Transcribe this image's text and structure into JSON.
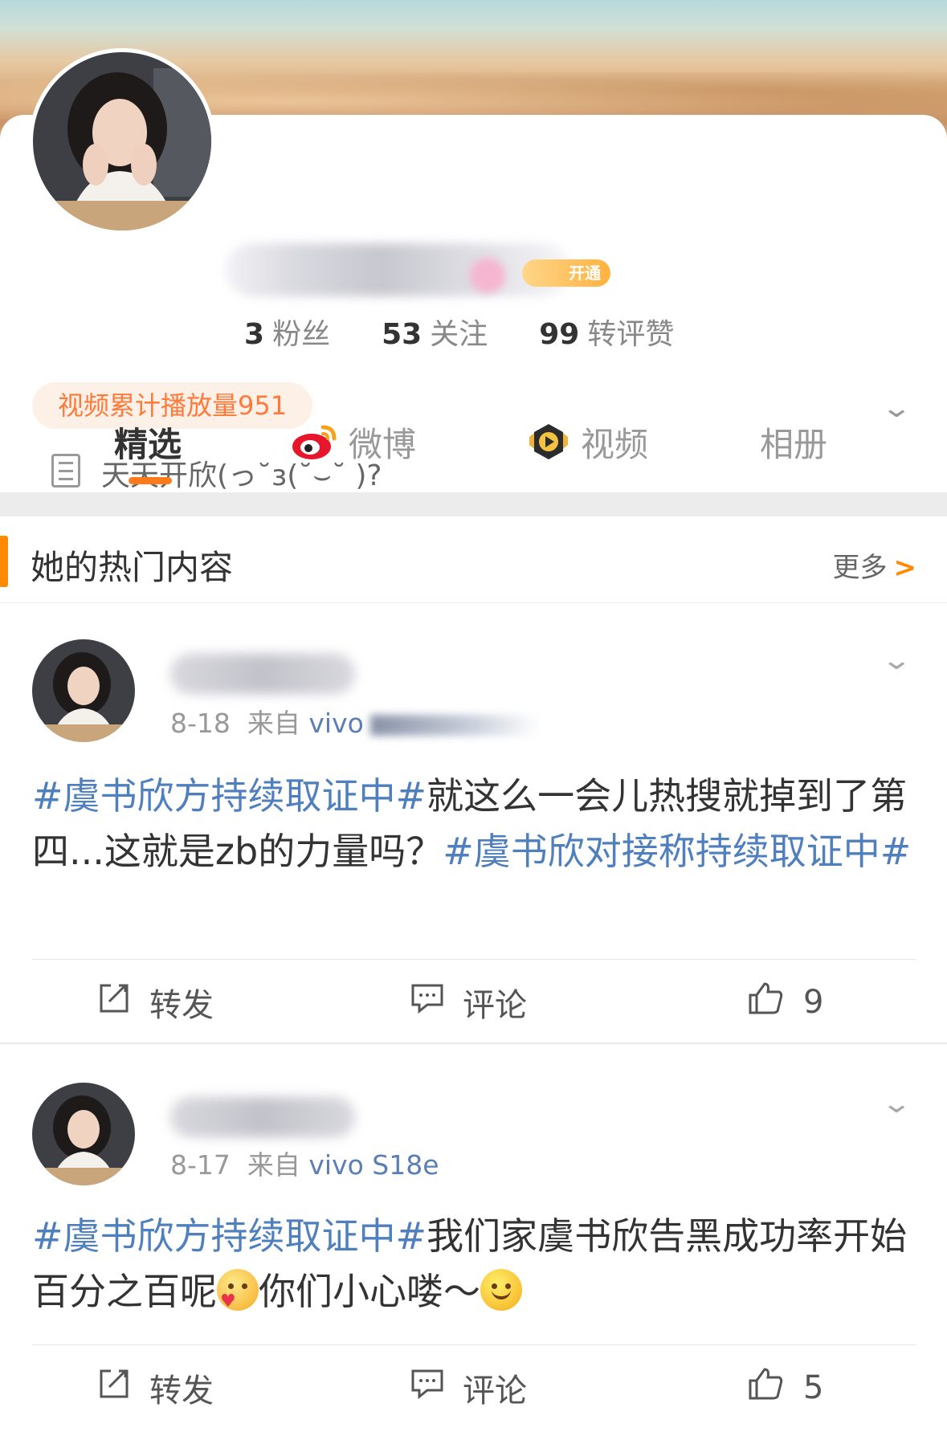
{
  "profile": {
    "vip_badge": "开通",
    "stats": [
      {
        "num": "3",
        "label": "粉丝"
      },
      {
        "num": "53",
        "label": "关注"
      },
      {
        "num": "99",
        "label": "转评赞"
      }
    ],
    "play_count_pill": "视频累计播放量951",
    "bio": "天天开欣(っ˘з(˘⌣˘ )?"
  },
  "tabs": [
    {
      "label": "精选",
      "active": true
    },
    {
      "label": "微博",
      "icon": "weibo-icon"
    },
    {
      "label": "视频",
      "icon": "video-play-icon"
    },
    {
      "label": "相册"
    }
  ],
  "hot_section": {
    "title": "她的热门内容",
    "more": "更多",
    "accent": "#ff8a00"
  },
  "posts": [
    {
      "date": "8-18",
      "source_prefix": "来自",
      "device": "vivo",
      "body": {
        "tag1": "#虞书欣方持续取证中#",
        "text1": "就这么一会儿热搜就掉到了第四...这就是zb的力量吗？",
        "tag2": "#虞书欣对接称持续取证中#"
      },
      "actions": {
        "repost": "转发",
        "comment": "评论",
        "likes": "9"
      }
    },
    {
      "date": "8-17",
      "source_prefix": "来自",
      "device": "vivo S18e",
      "body": {
        "tag1": "#虞书欣方持续取证中#",
        "text1": "我们家虞书欣告黑成功率开始百分之百呢",
        "text2": "你们小心喽～"
      },
      "actions": {
        "repost": "转发",
        "comment": "评论",
        "likes": "5"
      }
    }
  ],
  "colors": {
    "link": "#4f7fbd",
    "orange": "#ff7a1a",
    "pill_bg": "#fdf0e7"
  }
}
